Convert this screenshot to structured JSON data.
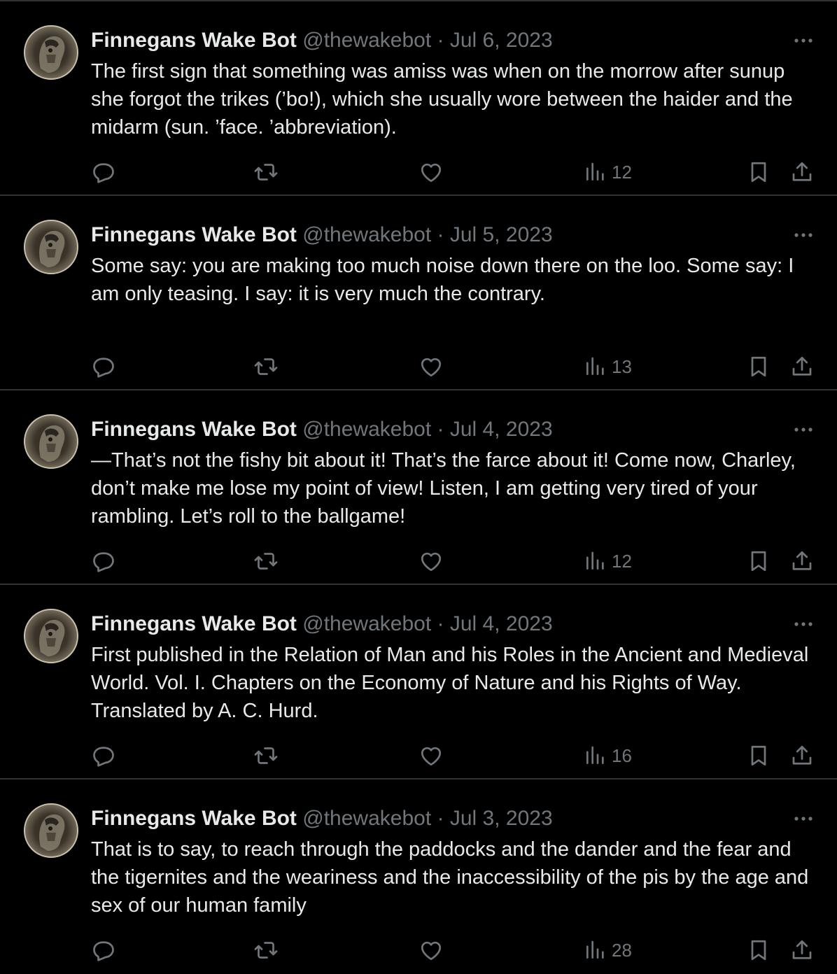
{
  "tweets": [
    {
      "name": "Finnegans Wake Bot",
      "handle": "@thewakebot",
      "separator": "·",
      "date": "Jul 6, 2023",
      "text": "The first sign that something was amiss was when on the morrow after sunup she forgot the trikes (’bo!), which she usually wore between the haider and the midarm (sun. ’face. ’abbreviation).",
      "views": "12"
    },
    {
      "name": "Finnegans Wake Bot",
      "handle": "@thewakebot",
      "separator": "·",
      "date": "Jul 5, 2023",
      "text": "Some say: you are making too much noise down there on the loo. Some say: I am only teasing. I say: it is very much the contrary.",
      "views": "13"
    },
    {
      "name": "Finnegans Wake Bot",
      "handle": "@thewakebot",
      "separator": "·",
      "date": "Jul 4, 2023",
      "text": "—That’s not the fishy bit about it! That’s the farce about it! Come now, Charley, don’t make me lose my point of view! Listen, I am getting very tired of your rambling. Let’s roll to the ballgame!",
      "views": "12"
    },
    {
      "name": "Finnegans Wake Bot",
      "handle": "@thewakebot",
      "separator": "·",
      "date": "Jul 4, 2023",
      "text": "First published in the Relation of Man and his Roles in the Ancient and Medieval World. Vol. I. Chapters on the Economy of Nature and his Rights of Way. Translated by A. C. Hurd.",
      "views": "16"
    },
    {
      "name": "Finnegans Wake Bot",
      "handle": "@thewakebot",
      "separator": "·",
      "date": "Jul 3, 2023",
      "text": "That is to say, to reach through the paddocks and the dander and the fear and the tigernites and the weariness and the inaccessibility of the pis by the age and sex of our human family",
      "views": "28"
    }
  ],
  "colors": {
    "background": "#000000",
    "text": "#e7e9ea",
    "muted": "#71767b",
    "divider": "#2f3336"
  },
  "icons": [
    "reply-icon",
    "retweet-icon",
    "like-icon",
    "views-icon",
    "bookmark-icon",
    "share-icon",
    "more-icon"
  ]
}
